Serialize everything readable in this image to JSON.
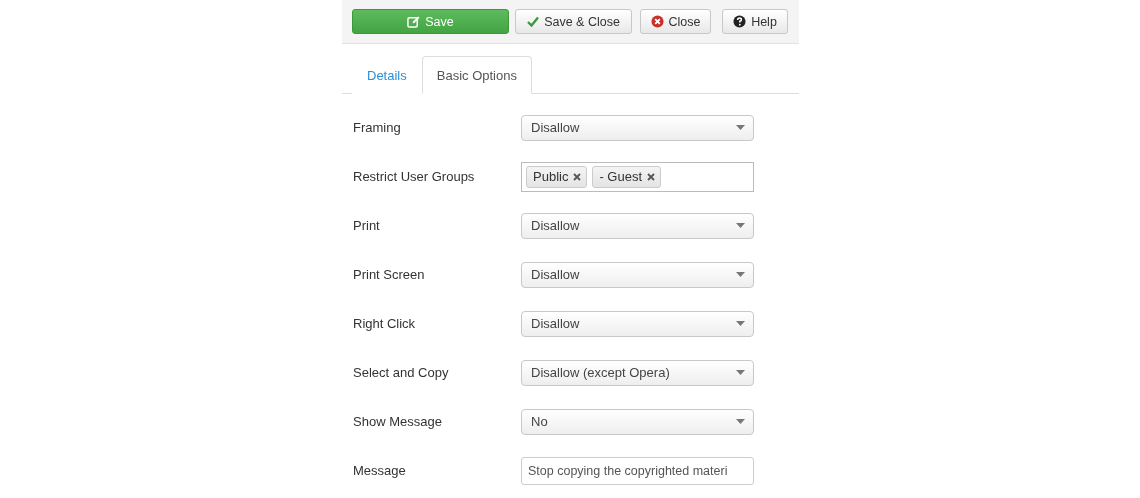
{
  "toolbar": {
    "buttons": [
      {
        "kind": "save",
        "label": "Save"
      },
      {
        "kind": "save-close",
        "label": "Save & Close"
      },
      {
        "kind": "close",
        "label": "Close"
      },
      {
        "kind": "help",
        "label": "Help"
      }
    ]
  },
  "tabs": [
    {
      "label": "Details",
      "selected": false
    },
    {
      "label": "Basic Options",
      "selected": true
    }
  ],
  "fields": [
    {
      "kind": "select",
      "label": "Framing",
      "value": "Disallow"
    },
    {
      "kind": "tags",
      "label": "Restrict User Groups",
      "tags": [
        "Public",
        "- Guest"
      ]
    },
    {
      "kind": "select",
      "label": "Print",
      "value": "Disallow"
    },
    {
      "kind": "select",
      "label": "Print Screen",
      "value": "Disallow"
    },
    {
      "kind": "select",
      "label": "Right Click",
      "value": "Disallow"
    },
    {
      "kind": "select",
      "label": "Select and Copy",
      "value": "Disallow (except Opera)"
    },
    {
      "kind": "select",
      "label": "Show Message",
      "value": "No"
    },
    {
      "kind": "text",
      "label": "Message",
      "value": "Stop copying the copyrighted materi"
    }
  ]
}
